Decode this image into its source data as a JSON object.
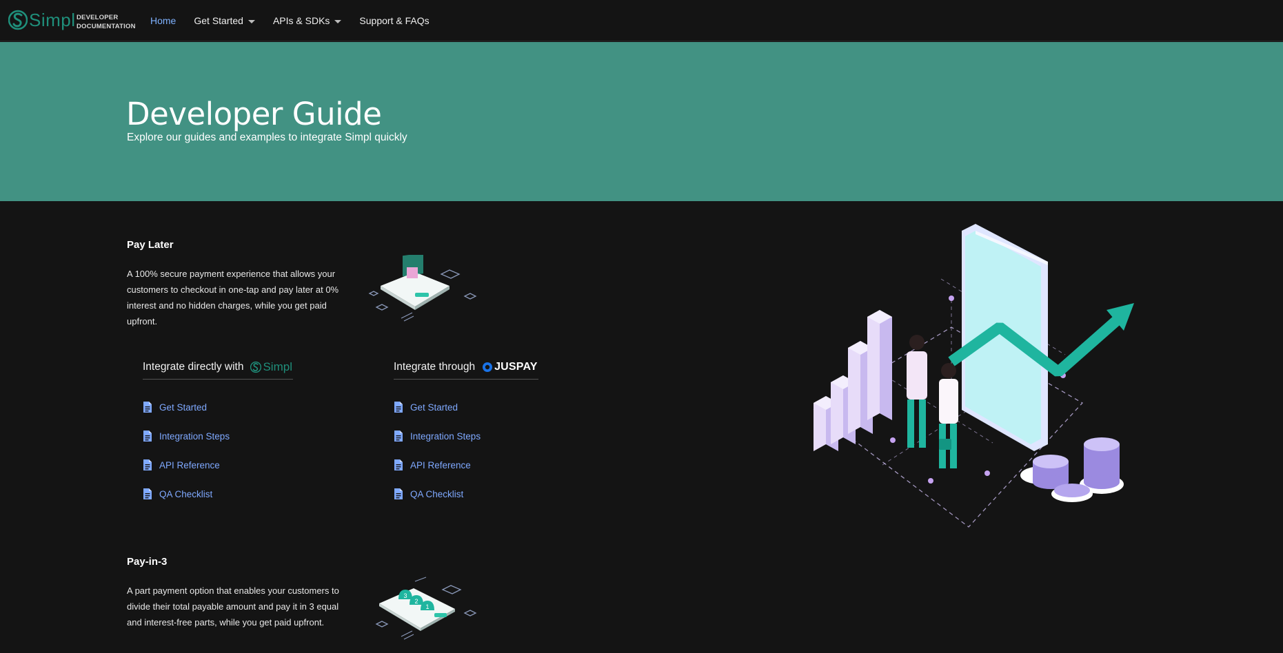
{
  "brand": {
    "name": "Simpl",
    "sub_line1": "DEVELOPER",
    "sub_line2": "DOCUMENTATION"
  },
  "nav": {
    "items": [
      {
        "label": "Home",
        "active": true,
        "dropdown": false
      },
      {
        "label": "Get Started",
        "active": false,
        "dropdown": true
      },
      {
        "label": "APIs & SDKs",
        "active": false,
        "dropdown": true
      },
      {
        "label": "Support & FAQs",
        "active": false,
        "dropdown": false
      }
    ]
  },
  "hero": {
    "title": "Developer Guide",
    "subtitle": "Explore our guides and examples to integrate Simpl quickly"
  },
  "pay_later": {
    "title": "Pay Later",
    "description": "A 100% secure payment experience that allows your customers to checkout in one-tap and pay later at 0% interest and no hidden charges, while you get paid upfront.",
    "direct": {
      "heading": "Integrate directly with",
      "logo_text": "Simpl",
      "links": [
        "Get Started",
        "Integration Steps",
        "API Reference",
        "QA Checklist"
      ]
    },
    "through": {
      "heading": "Integrate through",
      "logo_text": "JUSPAY",
      "links": [
        "Get Started",
        "Integration Steps",
        "API Reference",
        "QA Checklist"
      ]
    }
  },
  "pay_in_3": {
    "title": "Pay-in-3",
    "description": "A part payment option that enables your customers to divide their total payable amount and pay it in 3 equal and interest-free parts, while you get paid upfront.",
    "step_labels": [
      "3",
      "2",
      "1"
    ]
  },
  "colors": {
    "brand_teal": "#1f8f7b",
    "hero_bg": "#429283",
    "link_blue": "#7fa9ff",
    "nav_active": "#7fb2ff",
    "page_bg": "#141414"
  },
  "icons": {
    "doc_link": "document-icon",
    "brand": "simpl-logo-icon",
    "partner": "juspay-logo-icon"
  }
}
